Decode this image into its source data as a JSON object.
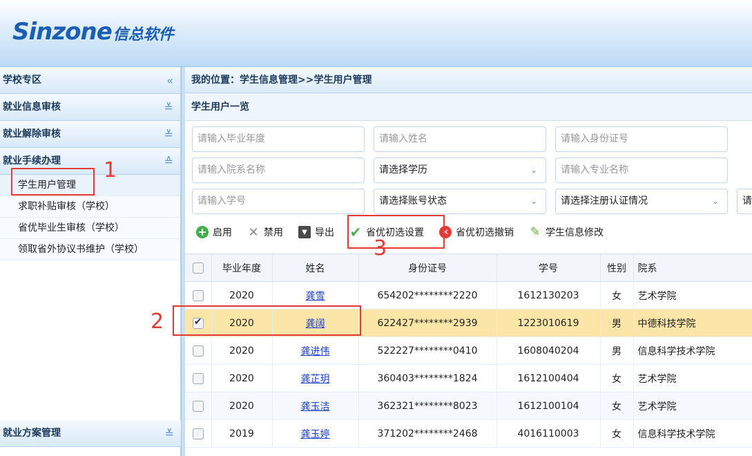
{
  "header": {
    "logo_en": "Sinzone",
    "logo_cn": "信总软件"
  },
  "sidebar": {
    "sections": [
      {
        "label": "学校专区",
        "chevron": "«"
      },
      {
        "label": "就业信息审核",
        "chevron": "≚"
      },
      {
        "label": "就业解除审核",
        "chevron": "≚"
      },
      {
        "label": "就业手续办理",
        "chevron": "≙"
      }
    ],
    "items": [
      "学生用户管理",
      "求职补贴审核（学校）",
      "省优毕业生审核（学校）",
      "领取省外协议书维护（学校）"
    ],
    "bottom_section": {
      "label": "就业方案管理",
      "chevron": "≚"
    }
  },
  "breadcrumb": "我的位置：学生信息管理>>学生用户管理",
  "panel_title": "学生用户一览",
  "filters": {
    "grad_year": "请输入毕业年度",
    "name": "请输入姓名",
    "id_card": "请输入身份证号",
    "department": "请输入院系名称",
    "education": "请选择学历",
    "major": "请输入专业名称",
    "student_no": "请输入学号",
    "account_status": "请选择账号状态",
    "register_status": "请选择注册认证情况",
    "extra": "请"
  },
  "toolbar": {
    "enable": "启用",
    "disable": "禁用",
    "export": "导出",
    "prov_set": "省优初选设置",
    "prov_cancel": "省优初选撤销",
    "edit_info": "学生信息修改"
  },
  "table": {
    "headers": {
      "year": "毕业年度",
      "name": "姓名",
      "id": "身份证号",
      "no": "学号",
      "gender": "性别",
      "dept": "院系"
    },
    "rows": [
      {
        "year": "2020",
        "name": "龚雪",
        "id": "654202********2220",
        "no": "1612130203",
        "gender": "女",
        "dept": "艺术学院"
      },
      {
        "year": "2020",
        "name": "龚阔",
        "id": "622427********2939",
        "no": "1223010619",
        "gender": "男",
        "dept": "中德科技学院"
      },
      {
        "year": "2020",
        "name": "龚进伟",
        "id": "522227********0410",
        "no": "1608040204",
        "gender": "男",
        "dept": "信息科学技术学院"
      },
      {
        "year": "2020",
        "name": "龚芷玥",
        "id": "360403********1824",
        "no": "1612100404",
        "gender": "女",
        "dept": "艺术学院"
      },
      {
        "year": "2020",
        "name": "龚玉洁",
        "id": "362321********8023",
        "no": "1612100104",
        "gender": "女",
        "dept": "艺术学院"
      },
      {
        "year": "2019",
        "name": "龚玉婷",
        "id": "371202********2468",
        "no": "4016110003",
        "gender": "女",
        "dept": "信息科学技术学院"
      }
    ]
  },
  "annotations": {
    "one": "1",
    "two": "2",
    "three": "3"
  },
  "colors": {
    "accent": "#1a5fb4",
    "annotation": "#e53935",
    "selected_row": "#fbe6a8"
  }
}
